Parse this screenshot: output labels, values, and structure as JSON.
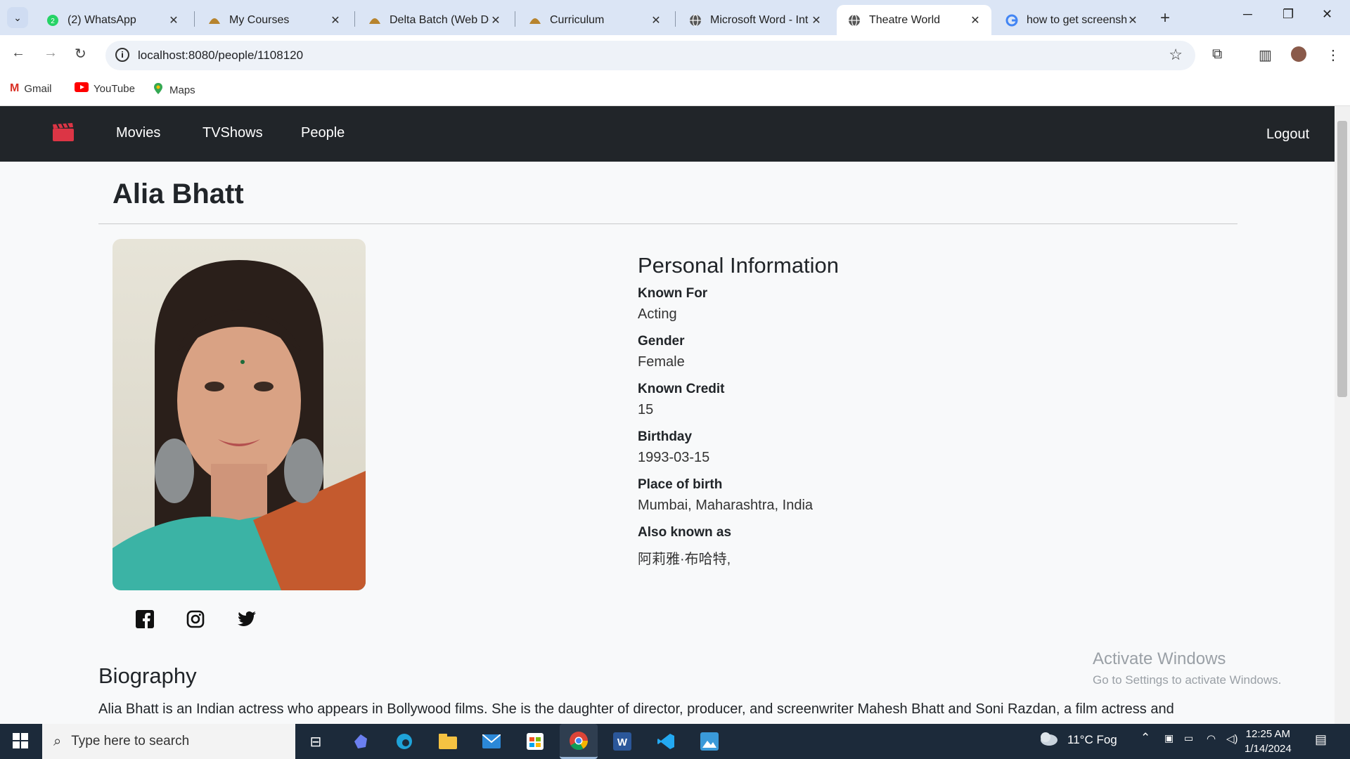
{
  "browser": {
    "tabs": [
      {
        "title": "(2) WhatsApp",
        "favicon": "whatsapp-icon"
      },
      {
        "title": "My Courses",
        "favicon": "course-icon"
      },
      {
        "title": "Delta Batch (Web De",
        "favicon": "course-icon"
      },
      {
        "title": "Curriculum",
        "favicon": "course-icon"
      },
      {
        "title": "Microsoft Word - Int",
        "favicon": "globe-icon"
      },
      {
        "title": "Theatre World",
        "favicon": "globe-icon",
        "active": true
      },
      {
        "title": "how to get screensh",
        "favicon": "google-icon"
      }
    ],
    "url": "localhost:8080/people/1108120",
    "bookmarks": [
      "Gmail",
      "YouTube",
      "Maps"
    ]
  },
  "navbar": {
    "links": [
      "Movies",
      "TVShows",
      "People"
    ],
    "logout": "Logout",
    "brand_color": "#dc3545"
  },
  "person": {
    "name": "Alia Bhatt",
    "social": [
      "facebook-icon",
      "instagram-icon",
      "twitter-icon"
    ]
  },
  "personal_info": {
    "title": "Personal Information",
    "fields": [
      {
        "label": "Known For",
        "value": "Acting"
      },
      {
        "label": "Gender",
        "value": "Female"
      },
      {
        "label": "Known Credit",
        "value": "15"
      },
      {
        "label": "Birthday",
        "value": "1993-03-15"
      },
      {
        "label": "Place of birth",
        "value": "Mumbai, Maharashtra, India"
      },
      {
        "label": "Also known as",
        "value": "阿莉雅·布哈特,"
      }
    ]
  },
  "biography": {
    "title": "Biography",
    "text": "Alia Bhatt is an Indian actress who appears in Bollywood films. She is the daughter of director, producer, and screenwriter Mahesh Bhatt and Soni Razdan, a film actress and"
  },
  "watermark": {
    "line1": "Activate Windows",
    "line2": "Go to Settings to activate Windows."
  },
  "taskbar": {
    "search_placeholder": "Type here to search",
    "weather": "11°C  Fog",
    "time": "12:25 AM",
    "date": "1/14/2024"
  }
}
